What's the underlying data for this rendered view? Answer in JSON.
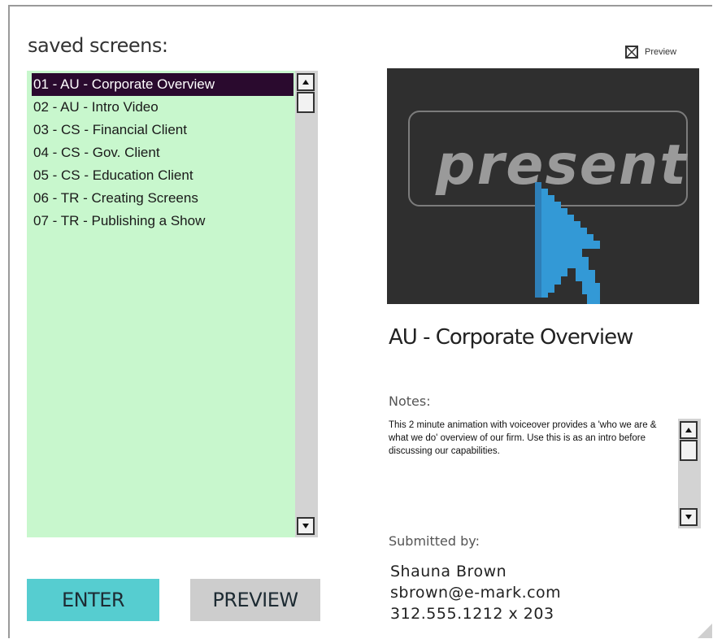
{
  "left": {
    "title": "saved screens:",
    "items": [
      {
        "label": "01 - AU - Corporate Overview",
        "selected": true
      },
      {
        "label": "02 - AU - Intro Video"
      },
      {
        "label": "03 - CS - Financial Client"
      },
      {
        "label": "04 - CS - Gov. Client"
      },
      {
        "label": "05 - CS - Education Client"
      },
      {
        "label": "06 - TR - Creating Screens"
      },
      {
        "label": "07 - TR - Publishing a Show"
      }
    ],
    "enter_label": "ENTER",
    "preview_label": "PREVIEW"
  },
  "right": {
    "preview_checkbox_label": "Preview",
    "preview_checked": true,
    "preview_image_text": "present",
    "screen_title": "AU - Corporate Overview",
    "notes_label": "Notes:",
    "notes": "This 2 minute animation with voiceover provides a 'who we are & what we do' overview of our firm. Use this is as an intro before discussing our capabilities.",
    "submitted_label": "Submitted by:",
    "submitter_name": "Shauna Brown",
    "submitter_email": "sbrown@e-mark.com",
    "submitter_phone": "312.555.1212 x 203"
  },
  "colors": {
    "list_bg": "#c8f7cd",
    "selected_bg": "#2a0a2e",
    "enter_bg": "#56cdd0",
    "preview_btn_bg": "#cdcdcd",
    "cursor_blue": "#3399d6"
  },
  "icons": {
    "scroll_up": "triangle-up-icon",
    "scroll_down": "triangle-down-icon",
    "checkbox": "checkbox-x-icon",
    "cursor": "pixel-arrow-cursor-icon"
  }
}
